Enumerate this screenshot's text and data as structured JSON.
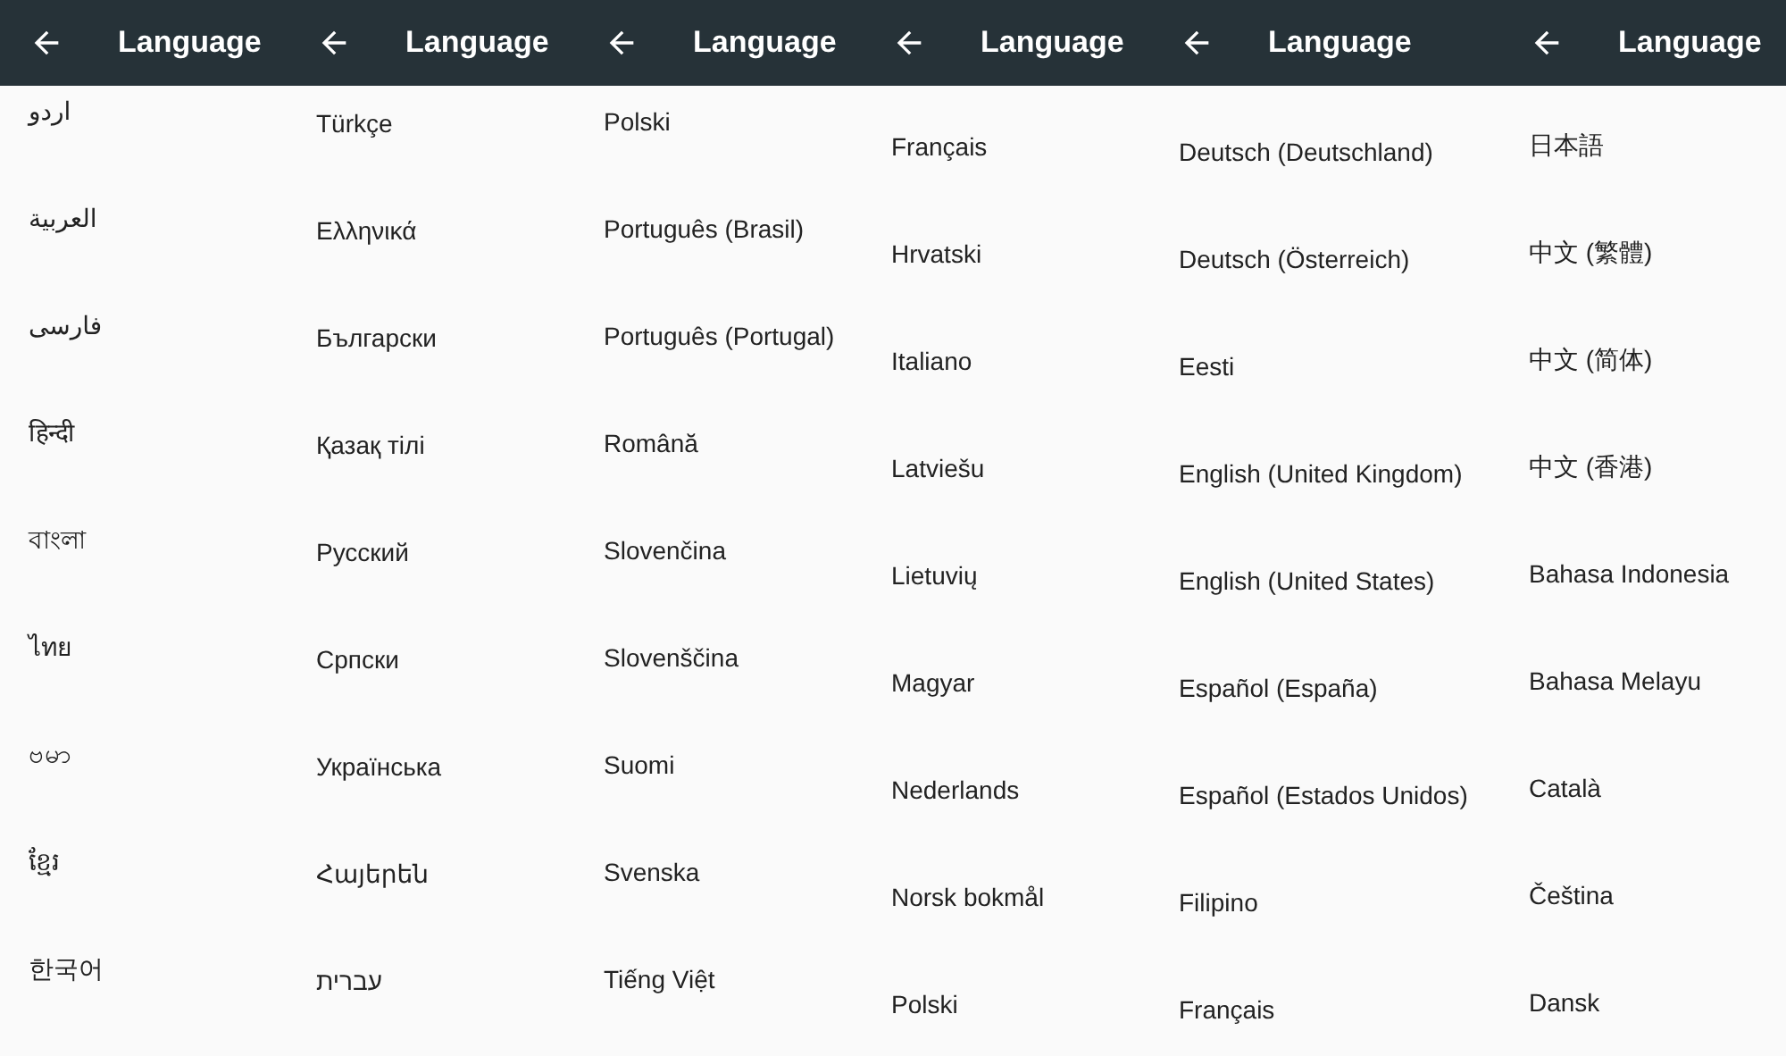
{
  "screens": [
    {
      "title": "Language",
      "items": [
        "اردو",
        "العربية",
        "فارسی",
        "हिन्दी",
        "বাংলা",
        "ไทย",
        "ဗမာ",
        "ខ្មែរ",
        "한국어"
      ]
    },
    {
      "title": "Language",
      "items": [
        "Türkçe",
        "Ελληνικά",
        "Български",
        "Қазақ тілі",
        "Русский",
        "Српски",
        "Українська",
        "Հայերեն",
        "עברית"
      ]
    },
    {
      "title": "Language",
      "items": [
        "Polski",
        "Português (Brasil)",
        "Português (Portugal)",
        "Română",
        "Slovenčina",
        "Slovenščina",
        "Suomi",
        "Svenska",
        "Tiếng Việt"
      ]
    },
    {
      "title": "Language",
      "items": [
        "Français",
        "Hrvatski",
        "Italiano",
        "Latviešu",
        "Lietuvių",
        "Magyar",
        "Nederlands",
        "Norsk bokmål",
        "Polski"
      ]
    },
    {
      "title": "Language",
      "items": [
        "Deutsch (Deutschland)",
        "Deutsch (Österreich)",
        "Eesti",
        "English (United Kingdom)",
        "English (United States)",
        "Español (España)",
        "Español (Estados Unidos)",
        "Filipino",
        "Français"
      ]
    },
    {
      "title": "Language",
      "items": [
        "日本語",
        "中文 (繁體)",
        "中文 (简体)",
        "中文 (香港)",
        "Bahasa Indonesia",
        "Bahasa Melayu",
        "Català",
        "Čeština",
        "Dansk"
      ]
    }
  ]
}
